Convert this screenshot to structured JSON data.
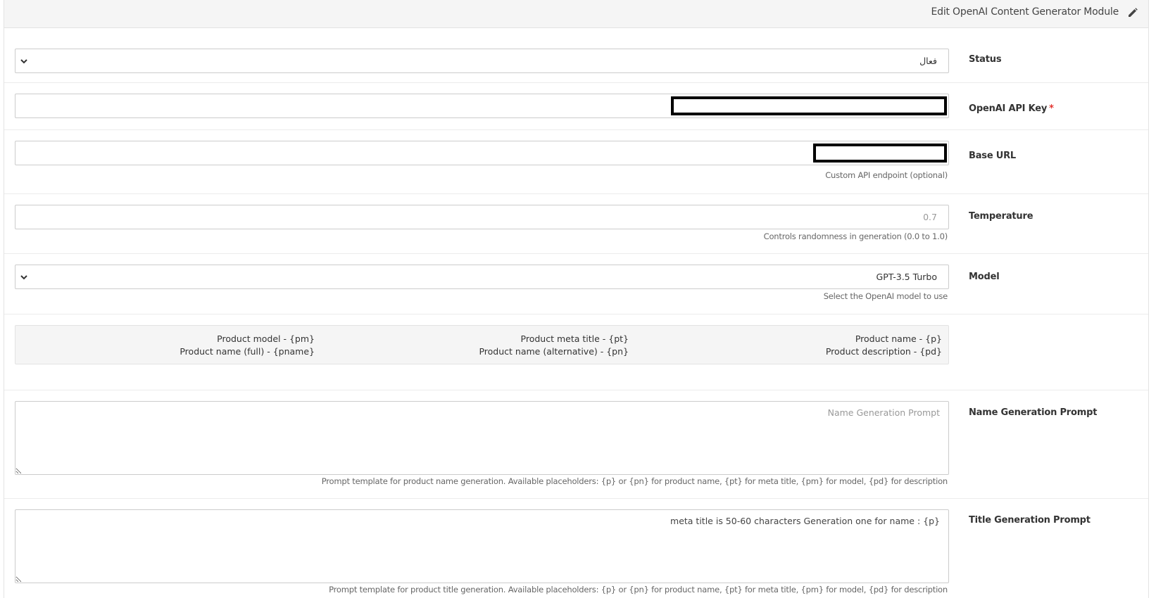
{
  "header": {
    "title": "Edit OpenAI Content Generator Module",
    "icon": "pencil-icon"
  },
  "fields": {
    "status": {
      "label": "Status",
      "value": "فعال"
    },
    "api_key": {
      "label": "OpenAI API Key",
      "required_mark": "*",
      "value": ""
    },
    "base_url": {
      "label": "Base URL",
      "value": "",
      "help": "Custom API endpoint (optional)"
    },
    "temperature": {
      "label": "Temperature",
      "placeholder": "0.7",
      "help": "Controls randomness in generation (0.0 to 1.0)"
    },
    "model": {
      "label": "Model",
      "value": "GPT-3.5 Turbo",
      "help": "Select the OpenAI model to use"
    },
    "placeholders": {
      "items": [
        "Product name - {p}",
        "Product description - {pd}",
        "Product meta title - {pt}",
        "Product name (alternative) - {pn}",
        "Product model - {pm}",
        "Product name (full) - {pname}"
      ]
    },
    "name_prompt": {
      "label": "Name Generation Prompt",
      "placeholder": "Name Generation Prompt",
      "value": "",
      "help": "Prompt template for product name generation. Available placeholders: {p} or {pn} for product name, {pt} for meta title, {pm} for model, {pd} for description"
    },
    "title_prompt": {
      "label": "Title Generation Prompt",
      "value": "meta title is 50-60 characters Generation one for name : {p}",
      "help": "Prompt template for product title generation. Available placeholders: {p} or {pn} for product name, {pt} for meta title, {pm} for model, {pd} for description"
    }
  },
  "colors": {
    "required": "#e3342f",
    "heading_bg": "#f5f5f5",
    "border": "#cccccc"
  }
}
